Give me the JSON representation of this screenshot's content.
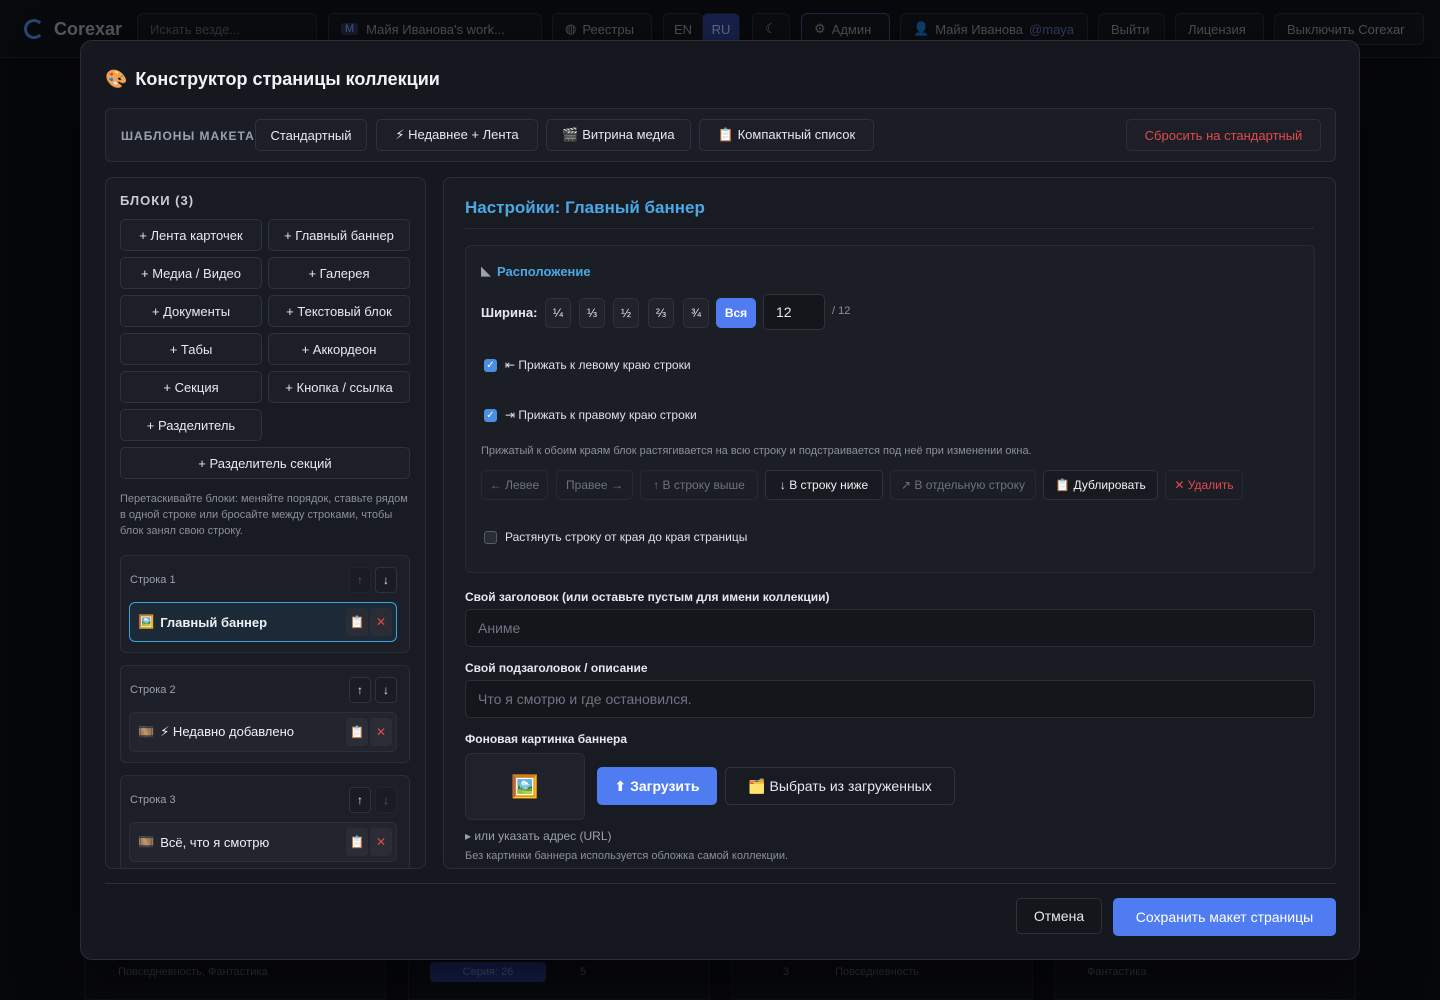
{
  "topbar": {
    "brand": "Corexar",
    "search_placeholder": "Искать везде...",
    "workspace": "Майя Иванова's work...",
    "workspace_badge": "M",
    "registries": "Реестры",
    "lang_en": "EN",
    "lang_ru": "RU",
    "admin": "Админ",
    "user_name": "Майя Иванова",
    "user_handle": "@maya",
    "logout": "Выйти",
    "license": "Лицензия",
    "disable": "Выключить Corexar"
  },
  "background": {
    "chip1": "Повседневность, Фантастика",
    "chip2": "Серия: 26",
    "chip3": "5",
    "chip4": "3",
    "chip5": "Повседневность",
    "chip6": "Фантастика"
  },
  "modal": {
    "title_icon": "🎨",
    "title": "Конструктор страницы коллекции",
    "templates_label": "ШАБЛОНЫ МАКЕТА:",
    "templates": {
      "standard": "Стандартный",
      "recent_feed": "⚡ Недавнее + Лента",
      "media": "🎬 Витрина медиа",
      "compact": "📋 Компактный список"
    },
    "reset": "Сбросить на стандартный",
    "blocks_title": "БЛОКИ (3)",
    "add": {
      "cards": "+ Лента карточек",
      "banner": "+ Главный баннер",
      "media": "+ Медиа / Видео",
      "gallery": "+ Галерея",
      "docs": "+ Документы",
      "text": "+ Текстовый блок",
      "tabs": "+ Табы",
      "accordion": "+ Аккордеон",
      "section": "+ Секция",
      "button": "+ Кнопка / ссылка",
      "divider": "+ Разделитель",
      "section_divider": "+ Разделитель секций"
    },
    "hint": "Перетаскивайте блоки: меняйте порядок, ставьте рядом в одной строке или бросайте между строками, чтобы блок занял свою строку.",
    "rows": [
      {
        "label": "Строка 1",
        "block": "Главный баннер",
        "icon": "🖼️"
      },
      {
        "label": "Строка 2",
        "block": "⚡ Недавно добавлено",
        "icon": "🎞️"
      },
      {
        "label": "Строка 3",
        "block": "Всё, что я смотрю",
        "icon": "🎞️"
      }
    ],
    "settings_title": "Настройки: Главный баннер",
    "placement_title": "Расположение",
    "width_label": "Ширина:",
    "widths": [
      "¼",
      "⅓",
      "½",
      "⅔",
      "¾",
      "Вся"
    ],
    "width_value": "12",
    "width_total": "/ 12",
    "pin_left": "⇤ Прижать к левому краю строки",
    "pin_right": "⇥ Прижать к правому краю строки",
    "pin_note": "Прижатый к обоим краям блок растягивается на всю строку и подстраивается под неё при изменении окна.",
    "actions": {
      "left": "← Левее",
      "right": "Правее →",
      "up": "↑ В строку выше",
      "down": "↓ В строку ниже",
      "separate": "↗ В отдельную строку",
      "duplicate": "📋 Дублировать",
      "delete": "✕ Удалить"
    },
    "stretch": "Растянуть строку от края до края страницы",
    "title_field_label": "Свой заголовок (или оставьте пустым для имени коллекции)",
    "title_field_placeholder": "Аниме",
    "subtitle_field_label": "Свой подзаголовок / описание",
    "subtitle_field_placeholder": "Что я смотрю и где остановился.",
    "bg_label": "Фоновая картинка баннера",
    "upload": "⬆ Загрузить",
    "choose": "🗂️ Выбрать из загруженных",
    "url_toggle": "▸ или указать адрес (URL)",
    "bg_note": "Без картинки баннера используется обложка самой коллекции.",
    "cancel": "Отмена",
    "save": "Сохранить макет страницы"
  }
}
